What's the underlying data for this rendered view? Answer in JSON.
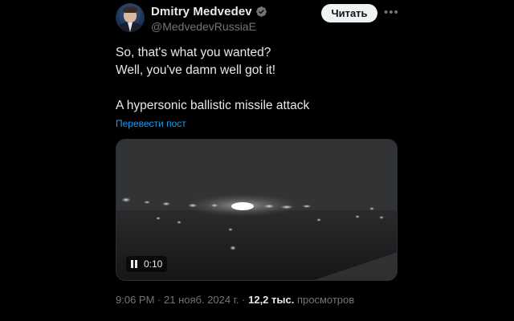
{
  "author": {
    "name": "Dmitry Medvedev",
    "handle": "@MedvedevRussiaE",
    "verified_color": "#71767b"
  },
  "follow_button": {
    "label": "Читать"
  },
  "more_icon": "more-horizontal-icon",
  "tweet": {
    "lines": [
      "So, that's what you wanted?",
      "Well, you've damn well got it!",
      "",
      "A hypersonic ballistic missile attack"
    ],
    "translate_label": "Перевести пост"
  },
  "video": {
    "time": "0:10",
    "state_icon": "pause-icon"
  },
  "meta": {
    "time": "9:06 PM",
    "separator": "·",
    "date": "21 нояб. 2024 г.",
    "views_count": "12,2 тыс.",
    "views_label": "просмотров"
  },
  "colors": {
    "background": "#000000",
    "text": "#e7e9ea",
    "secondary": "#71767b",
    "link": "#1d9bf0",
    "button_bg": "#eff3f4"
  }
}
